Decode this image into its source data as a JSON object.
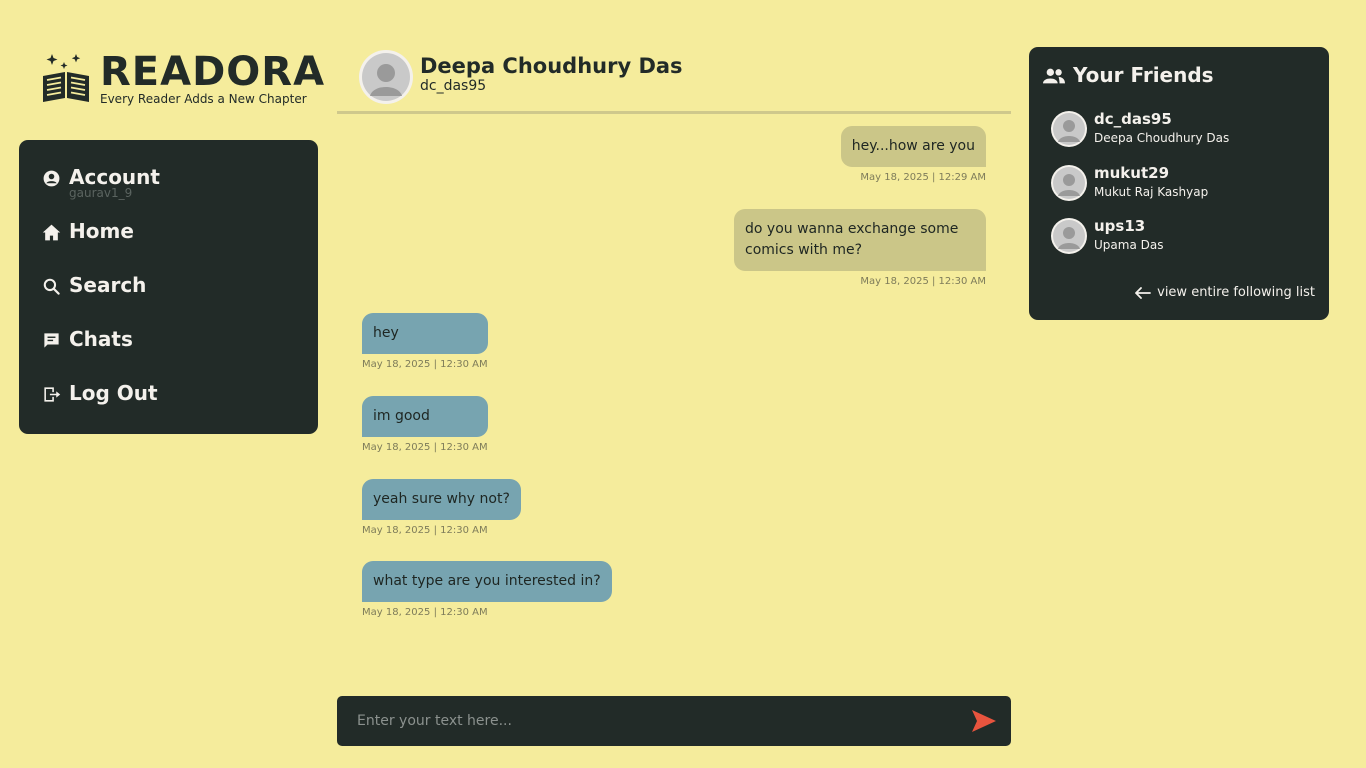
{
  "brand": {
    "title": "READORA",
    "tagline": "Every Reader Adds a New Chapter"
  },
  "nav": {
    "account": {
      "label": "Account",
      "username": "gaurav1_9"
    },
    "items": [
      {
        "label": "Home",
        "icon": "home-icon"
      },
      {
        "label": "Search",
        "icon": "search-icon"
      },
      {
        "label": "Chats",
        "icon": "chat-icon"
      },
      {
        "label": "Log Out",
        "icon": "logout-icon"
      }
    ]
  },
  "chat": {
    "name": "Deepa Choudhury Das",
    "username": "dc_das95",
    "messages": [
      {
        "dir": "sent",
        "text": "hey...how are you",
        "time": "May 18, 2025  |  12:29 AM"
      },
      {
        "dir": "sent",
        "text": "do you wanna exchange some\ncomics with me?",
        "time": "May 18, 2025  |  12:30 AM"
      },
      {
        "dir": "recv",
        "text": "hey",
        "time": "May 18, 2025  |  12:30 AM"
      },
      {
        "dir": "recv",
        "text": "im good",
        "time": "May 18, 2025  |  12:30 AM"
      },
      {
        "dir": "recv",
        "text": "yeah sure why not?",
        "time": "May 18, 2025  |  12:30 AM"
      },
      {
        "dir": "recv",
        "text": "what type are you interested in?",
        "time": "May 18, 2025  |  12:30 AM"
      }
    ],
    "input_placeholder": "Enter your text here..."
  },
  "friends": {
    "title": "Your Friends",
    "list": [
      {
        "username": "dc_das95",
        "name": "Deepa Choudhury Das"
      },
      {
        "username": "mukut29",
        "name": "Mukut Raj Kashyap"
      },
      {
        "username": "ups13",
        "name": "Upama Das"
      }
    ],
    "view_all": "view entire following list"
  },
  "colors": {
    "background": "#f5ec9c",
    "panel": "#222b28",
    "sent_bubble": "#cbc688",
    "received_bubble": "#77a4b0",
    "send_accent": "#e8543e"
  }
}
